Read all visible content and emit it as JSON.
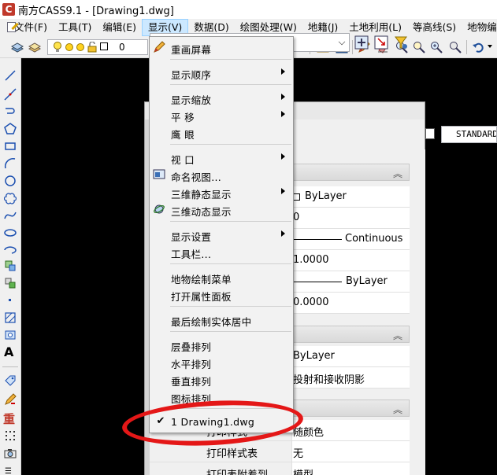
{
  "window": {
    "title": "南方CASS9.1 - [Drawing1.dwg]",
    "logo": "C"
  },
  "menubar": {
    "items": [
      "文件(F)",
      "工具(T)",
      "编辑(E)",
      "显示(V)",
      "数据(D)",
      "绘图处理(W)",
      "地籍(J)",
      "土地利用(L)",
      "等高线(S)",
      "地物编"
    ],
    "active": "显示(V)"
  },
  "toolbar": {
    "layer_value": "0",
    "text_style": "STANDARD"
  },
  "display_menu": {
    "items": [
      {
        "label": "重画屏幕",
        "icon": "pencil-icon"
      },
      {
        "label": "显示顺序",
        "submenu": true
      },
      {
        "label": "显示缩放",
        "submenu": true
      },
      {
        "label": "平    移",
        "submenu": true
      },
      {
        "label": "鹰    眼"
      },
      {
        "label": "视    口",
        "submenu": true
      },
      {
        "label": "命名视图...",
        "icon": "named-view-icon"
      },
      {
        "label": "三维静态显示",
        "submenu": true
      },
      {
        "label": "三维动态显示",
        "icon": "orbit-icon"
      },
      {
        "label": "显示设置",
        "submenu": true
      },
      {
        "label": "工具栏..."
      },
      {
        "label": "地物绘制菜单"
      },
      {
        "label": "打开属性面板"
      },
      {
        "label": "最后绘制实体居中"
      },
      {
        "label": "层叠排列"
      },
      {
        "label": "水平排列"
      },
      {
        "label": "垂直排列"
      },
      {
        "label": "图标排列"
      },
      {
        "label": "1 Drawing1.dwg",
        "checked": true
      }
    ]
  },
  "properties": {
    "rows": [
      {
        "value": "ByLayer"
      },
      {
        "value": "0"
      },
      {
        "value": "Continuous"
      },
      {
        "value": "1.0000"
      },
      {
        "value": "ByLayer"
      },
      {
        "value": "0.0000"
      },
      {
        "value": "ByLayer"
      },
      {
        "value": "投射和接收阴影"
      },
      {
        "label": "打印样式",
        "value": "随颜色"
      },
      {
        "label": "打印样式表",
        "value": "无"
      },
      {
        "label": "打印表附着到",
        "value": "模型"
      }
    ]
  },
  "colors": {
    "accent": "#cce8ff",
    "highlight_circle": "#e41717",
    "drawing_bg": "#000000"
  }
}
